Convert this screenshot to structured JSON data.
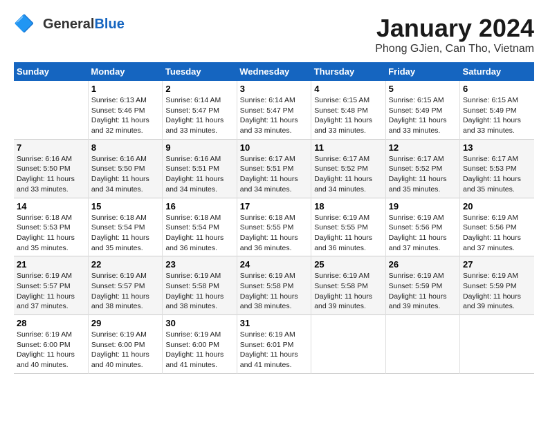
{
  "header": {
    "logo_general": "General",
    "logo_blue": "Blue",
    "month_title": "January 2024",
    "subtitle": "Phong GJien, Can Tho, Vietnam"
  },
  "days_of_week": [
    "Sunday",
    "Monday",
    "Tuesday",
    "Wednesday",
    "Thursday",
    "Friday",
    "Saturday"
  ],
  "weeks": [
    [
      {
        "day": "",
        "sunrise": "",
        "sunset": "",
        "daylight": ""
      },
      {
        "day": "1",
        "sunrise": "6:13 AM",
        "sunset": "5:46 PM",
        "daylight": "11 hours and 32 minutes."
      },
      {
        "day": "2",
        "sunrise": "6:14 AM",
        "sunset": "5:47 PM",
        "daylight": "11 hours and 33 minutes."
      },
      {
        "day": "3",
        "sunrise": "6:14 AM",
        "sunset": "5:47 PM",
        "daylight": "11 hours and 33 minutes."
      },
      {
        "day": "4",
        "sunrise": "6:15 AM",
        "sunset": "5:48 PM",
        "daylight": "11 hours and 33 minutes."
      },
      {
        "day": "5",
        "sunrise": "6:15 AM",
        "sunset": "5:49 PM",
        "daylight": "11 hours and 33 minutes."
      },
      {
        "day": "6",
        "sunrise": "6:15 AM",
        "sunset": "5:49 PM",
        "daylight": "11 hours and 33 minutes."
      }
    ],
    [
      {
        "day": "7",
        "sunrise": "6:16 AM",
        "sunset": "5:50 PM",
        "daylight": "11 hours and 33 minutes."
      },
      {
        "day": "8",
        "sunrise": "6:16 AM",
        "sunset": "5:50 PM",
        "daylight": "11 hours and 34 minutes."
      },
      {
        "day": "9",
        "sunrise": "6:16 AM",
        "sunset": "5:51 PM",
        "daylight": "11 hours and 34 minutes."
      },
      {
        "day": "10",
        "sunrise": "6:17 AM",
        "sunset": "5:51 PM",
        "daylight": "11 hours and 34 minutes."
      },
      {
        "day": "11",
        "sunrise": "6:17 AM",
        "sunset": "5:52 PM",
        "daylight": "11 hours and 34 minutes."
      },
      {
        "day": "12",
        "sunrise": "6:17 AM",
        "sunset": "5:52 PM",
        "daylight": "11 hours and 35 minutes."
      },
      {
        "day": "13",
        "sunrise": "6:17 AM",
        "sunset": "5:53 PM",
        "daylight": "11 hours and 35 minutes."
      }
    ],
    [
      {
        "day": "14",
        "sunrise": "6:18 AM",
        "sunset": "5:53 PM",
        "daylight": "11 hours and 35 minutes."
      },
      {
        "day": "15",
        "sunrise": "6:18 AM",
        "sunset": "5:54 PM",
        "daylight": "11 hours and 35 minutes."
      },
      {
        "day": "16",
        "sunrise": "6:18 AM",
        "sunset": "5:54 PM",
        "daylight": "11 hours and 36 minutes."
      },
      {
        "day": "17",
        "sunrise": "6:18 AM",
        "sunset": "5:55 PM",
        "daylight": "11 hours and 36 minutes."
      },
      {
        "day": "18",
        "sunrise": "6:19 AM",
        "sunset": "5:55 PM",
        "daylight": "11 hours and 36 minutes."
      },
      {
        "day": "19",
        "sunrise": "6:19 AM",
        "sunset": "5:56 PM",
        "daylight": "11 hours and 37 minutes."
      },
      {
        "day": "20",
        "sunrise": "6:19 AM",
        "sunset": "5:56 PM",
        "daylight": "11 hours and 37 minutes."
      }
    ],
    [
      {
        "day": "21",
        "sunrise": "6:19 AM",
        "sunset": "5:57 PM",
        "daylight": "11 hours and 37 minutes."
      },
      {
        "day": "22",
        "sunrise": "6:19 AM",
        "sunset": "5:57 PM",
        "daylight": "11 hours and 38 minutes."
      },
      {
        "day": "23",
        "sunrise": "6:19 AM",
        "sunset": "5:58 PM",
        "daylight": "11 hours and 38 minutes."
      },
      {
        "day": "24",
        "sunrise": "6:19 AM",
        "sunset": "5:58 PM",
        "daylight": "11 hours and 38 minutes."
      },
      {
        "day": "25",
        "sunrise": "6:19 AM",
        "sunset": "5:58 PM",
        "daylight": "11 hours and 39 minutes."
      },
      {
        "day": "26",
        "sunrise": "6:19 AM",
        "sunset": "5:59 PM",
        "daylight": "11 hours and 39 minutes."
      },
      {
        "day": "27",
        "sunrise": "6:19 AM",
        "sunset": "5:59 PM",
        "daylight": "11 hours and 39 minutes."
      }
    ],
    [
      {
        "day": "28",
        "sunrise": "6:19 AM",
        "sunset": "6:00 PM",
        "daylight": "11 hours and 40 minutes."
      },
      {
        "day": "29",
        "sunrise": "6:19 AM",
        "sunset": "6:00 PM",
        "daylight": "11 hours and 40 minutes."
      },
      {
        "day": "30",
        "sunrise": "6:19 AM",
        "sunset": "6:00 PM",
        "daylight": "11 hours and 41 minutes."
      },
      {
        "day": "31",
        "sunrise": "6:19 AM",
        "sunset": "6:01 PM",
        "daylight": "11 hours and 41 minutes."
      },
      {
        "day": "",
        "sunrise": "",
        "sunset": "",
        "daylight": ""
      },
      {
        "day": "",
        "sunrise": "",
        "sunset": "",
        "daylight": ""
      },
      {
        "day": "",
        "sunrise": "",
        "sunset": "",
        "daylight": ""
      }
    ]
  ]
}
